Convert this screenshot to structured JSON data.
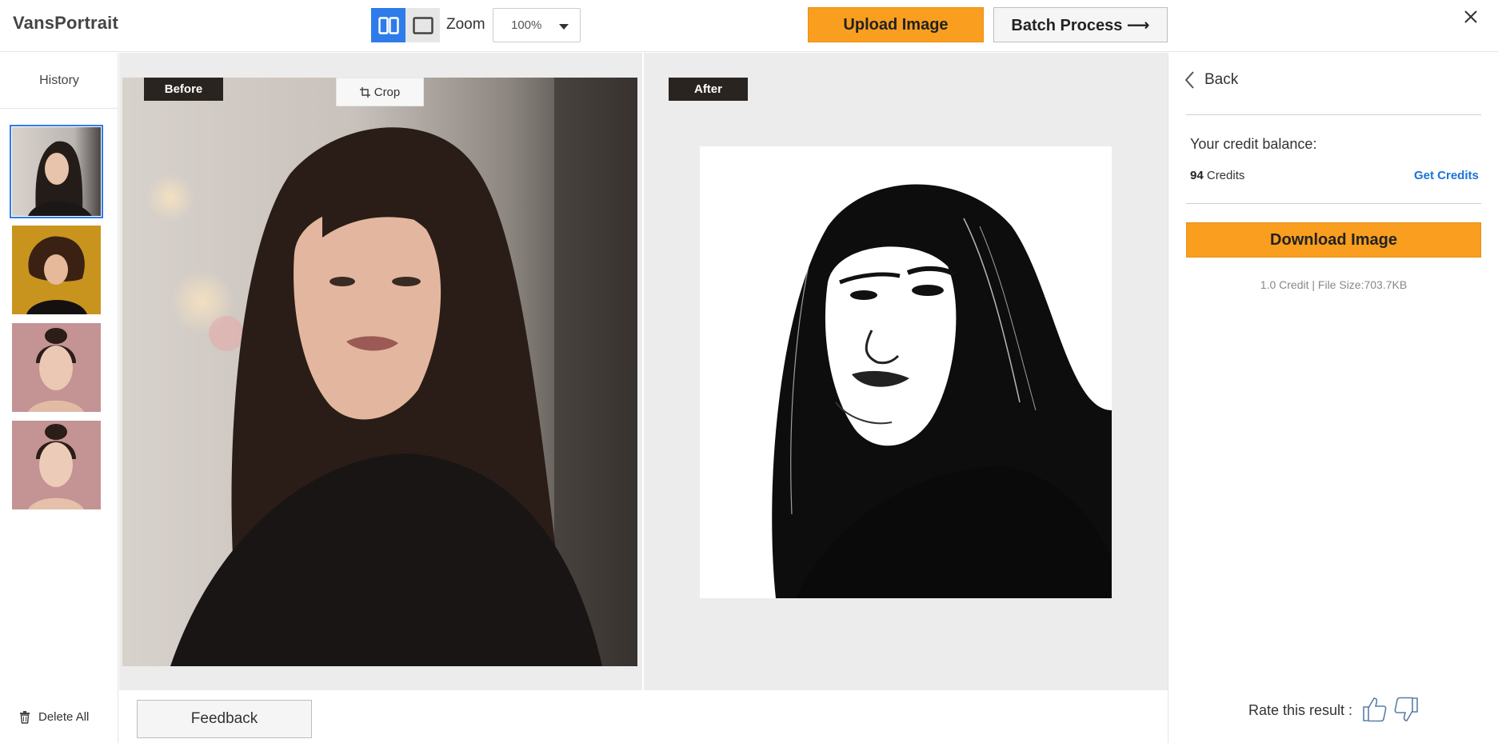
{
  "app": {
    "name": "VansPortrait"
  },
  "toolbar": {
    "zoom_label": "Zoom",
    "zoom_value": "100%",
    "upload_label": "Upload Image",
    "batch_label": "Batch Process ⟶"
  },
  "sidebar": {
    "title": "History",
    "thumbnails": [
      "portrait-1",
      "portrait-2",
      "portrait-3",
      "portrait-4"
    ],
    "delete_all_label": "Delete All"
  },
  "compare": {
    "before_label": "Before",
    "after_label": "After",
    "crop_label": "Crop"
  },
  "feedback_label": "Feedback",
  "panel": {
    "back_label": "Back",
    "credit_balance_label": "Your credit balance:",
    "credit_count": "94",
    "credit_unit": "Credits",
    "get_credits_label": "Get Credits",
    "download_label": "Download Image",
    "file_info": "1.0 Credit | File Size:703.7KB",
    "rate_label": "Rate this result :"
  },
  "colors": {
    "accent_orange": "#f99e1f",
    "accent_blue": "#2e7bea",
    "link_blue": "#1a73d9"
  }
}
